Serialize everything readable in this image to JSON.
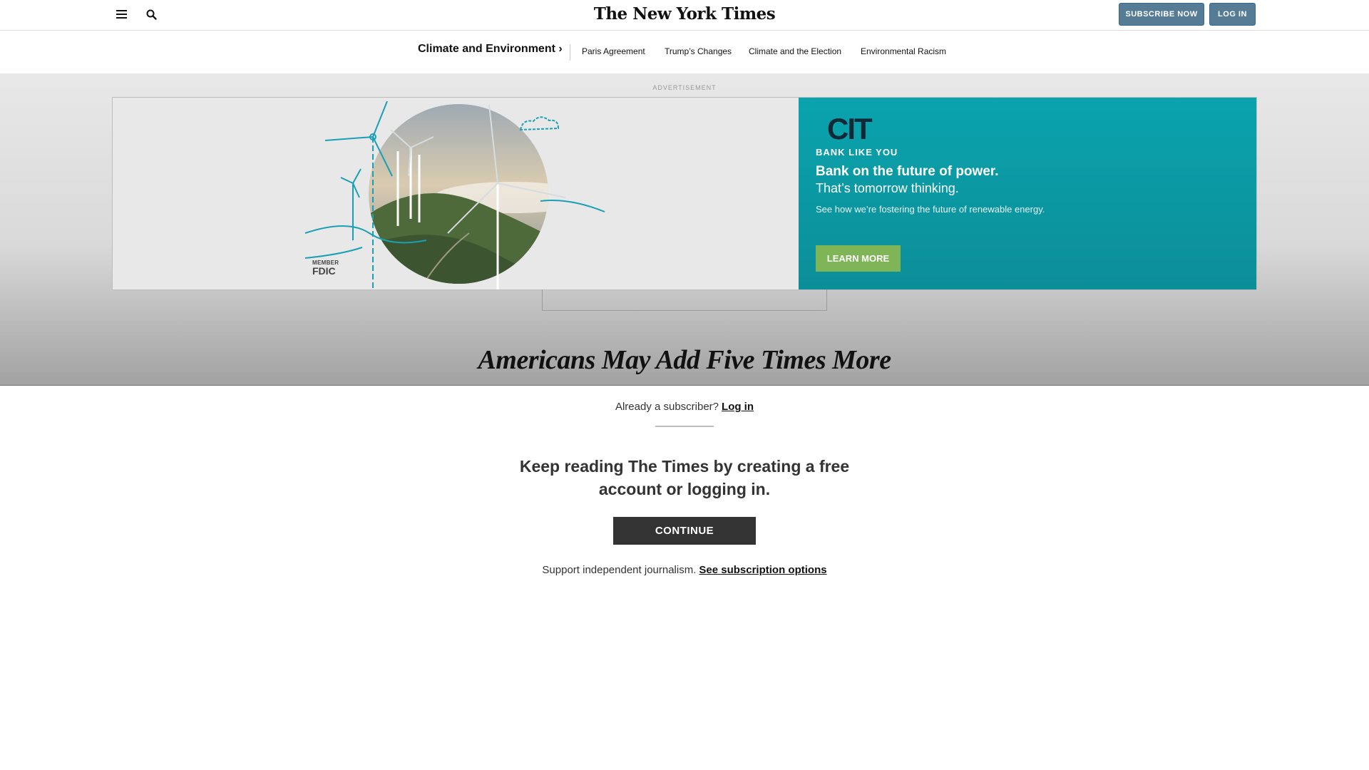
{
  "masthead": {
    "logo_text": "The New York Times",
    "subscribe_label": "SUBSCRIBE NOW",
    "login_label": "LOG IN"
  },
  "section_nav": {
    "title": "Climate and Environment ›",
    "items": [
      "Paris Agreement",
      "Trump’s Changes",
      "Climate and the Election",
      "Environmental Racism"
    ]
  },
  "ad": {
    "label": "ADVERTISEMENT",
    "fdic_small": "MEMBER",
    "fdic_big": "FDIC",
    "brand": "CIT",
    "tagline": "BANK LIKE YOU",
    "headline": "Bank on the future of power.",
    "subhead": "That’s tomorrow thinking.",
    "body": "See how we’re fostering the future of renewable energy.",
    "cta": "LEARN MORE",
    "colors": {
      "teal": "#0aa3ae",
      "cta_green": "#7fb457",
      "navy": "#0e2a36"
    }
  },
  "article": {
    "headline": "Americans May Add Five Times More"
  },
  "paywall": {
    "already_text": "Already a subscriber?",
    "login_link": "Log in",
    "keep_reading": "Keep reading The Times by creating a free account or logging in.",
    "continue_label": "CONTINUE",
    "support_text": "Support independent journalism.",
    "options_link": "See subscription options"
  },
  "icons": {
    "menu": "hamburger-menu-icon",
    "search": "search-icon"
  },
  "colors": {
    "button_blue": "#567b95",
    "dark_button": "#333333"
  }
}
